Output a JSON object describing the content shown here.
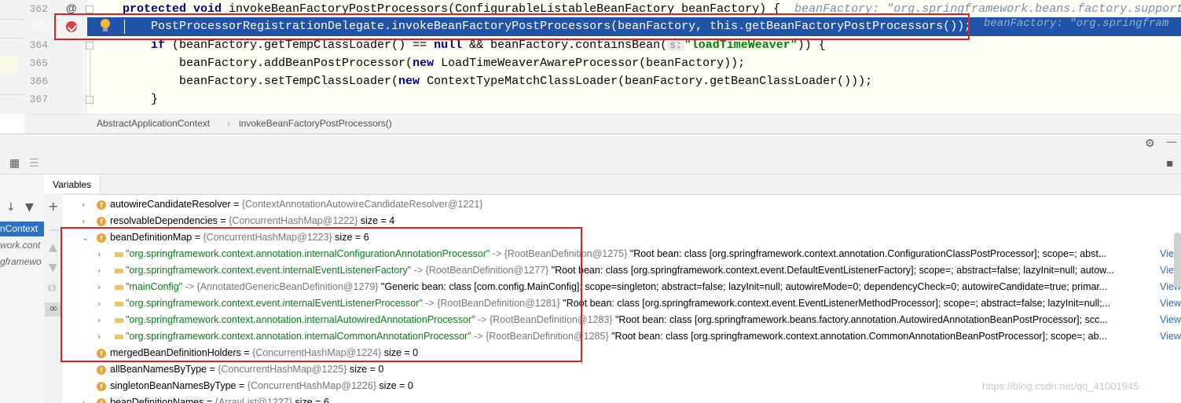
{
  "editor": {
    "lines": [
      {
        "num": "362",
        "kw": "protected void ",
        "code": "invokeBeanFactoryPostProcessors(ConfigurableListableBeanFactory beanFactory) {",
        "hint": "beanFactory: \"org.springframework.beans.factory.support"
      },
      {
        "num": "363",
        "code": "PostProcessorRegistrationDelegate.invokeBeanFactoryPostProcessors(beanFactory, this.getBeanFactoryPostProcessors());",
        "hint": "beanFactory: \"org.springfram"
      },
      {
        "num": "364",
        "kw": "if ",
        "code_a": "(beanFactory.getTempClassLoader() == ",
        "kw2": "null",
        "code_b": " && beanFactory.containsBean(",
        "param": "s:",
        "str": "\"loadTimeWeaver\"",
        "code_c": ")) {"
      },
      {
        "num": "365",
        "code_a": "beanFactory.addBeanPostProcessor(",
        "kw": "new ",
        "code_b": "LoadTimeWeaverAwareProcessor(beanFactory));"
      },
      {
        "num": "366",
        "code_a": "beanFactory.setTempClassLoader(",
        "kw": "new ",
        "code_b": "ContextTypeMatchClassLoader(beanFactory.getBeanClassLoader()));"
      },
      {
        "num": "367",
        "code": "}"
      }
    ],
    "at_symbol": "@"
  },
  "breadcrumb": {
    "class_name": "AbstractApplicationContext",
    "separator": "›",
    "method_name": "invokeBeanFactoryPostProcessors()"
  },
  "debug": {
    "tab_label": "Variables",
    "frames": [
      {
        "label": "nContext",
        "selected": true
      },
      {
        "label": "work.cont",
        "selected": false
      },
      {
        "label": "gframewo",
        "selected": false
      }
    ],
    "variables": [
      {
        "name": "autowireCandidateResolver",
        "eq": " = ",
        "value": "{ContextAnnotationAutowireCandidateResolver@1221}",
        "extra": "",
        "level": 0,
        "badge": "f",
        "arrow": "›"
      },
      {
        "name": "resolvableDependencies",
        "eq": " = ",
        "value": "{ConcurrentHashMap@1222}",
        "extra": "  size = 4",
        "level": 0,
        "badge": "f",
        "arrow": "›"
      },
      {
        "name": "beanDefinitionMap",
        "eq": " = ",
        "value": "{ConcurrentHashMap@1223}",
        "extra": "  size = 6",
        "level": 0,
        "badge": "f",
        "arrow": "⌄"
      },
      {
        "key": "\"org.springframework.context.annotation.internalConfigurationAnnotationProcessor\"",
        "op": " -> ",
        "value": "{RootBeanDefinition@1275}",
        "desc": " \"Root bean: class [org.springframework.context.annotation.ConfigurationClassPostProcessor]; scope=; abst...",
        "level": 1,
        "arrow": "›",
        "view": "View"
      },
      {
        "key": "\"org.springframework.context.event.internalEventListenerFactory\"",
        "op": " -> ",
        "value": "{RootBeanDefinition@1277}",
        "desc": " \"Root bean: class [org.springframework.context.event.DefaultEventListenerFactory]; scope=; abstract=false; lazyInit=null; autow...",
        "level": 1,
        "arrow": "›",
        "view": "View"
      },
      {
        "key": "\"mainConfig\"",
        "op": " -> ",
        "value": "{AnnotatedGenericBeanDefinition@1279}",
        "desc": " \"Generic bean: class [com.config.MainConfig]; scope=singleton; abstract=false; lazyInit=null; autowireMode=0; dependencyCheck=0; autowireCandidate=true; primar...",
        "level": 1,
        "arrow": "›",
        "view": "View"
      },
      {
        "key": "\"org.springframework.context.event.internalEventListenerProcessor\"",
        "op": " -> ",
        "value": "{RootBeanDefinition@1281}",
        "desc": " \"Root bean: class [org.springframework.context.event.EventListenerMethodProcessor]; scope=; abstract=false; lazyInit=null;...",
        "level": 1,
        "arrow": "›",
        "view": "View"
      },
      {
        "key": "\"org.springframework.context.annotation.internalAutowiredAnnotationProcessor\"",
        "op": " -> ",
        "value": "{RootBeanDefinition@1283}",
        "desc": " \"Root bean: class [org.springframework.beans.factory.annotation.AutowiredAnnotationBeanPostProcessor]; scc...",
        "level": 1,
        "arrow": "›",
        "view": "View"
      },
      {
        "key": "\"org.springframework.context.annotation.internalCommonAnnotationProcessor\"",
        "op": " -> ",
        "value": "{RootBeanDefinition@1285}",
        "desc": " \"Root bean: class [org.springframework.context.annotation.CommonAnnotationBeanPostProcessor]; scope=; ab...",
        "level": 1,
        "arrow": "›",
        "view": "View"
      },
      {
        "name": "mergedBeanDefinitionHolders",
        "eq": " = ",
        "value": "{ConcurrentHashMap@1224}",
        "extra": "  size = 0",
        "level": 0,
        "badge": "f",
        "arrow": ""
      },
      {
        "name": "allBeanNamesByType",
        "eq": " = ",
        "value": "{ConcurrentHashMap@1225}",
        "extra": "  size = 0",
        "level": 0,
        "badge": "f",
        "arrow": ""
      },
      {
        "name": "singletonBeanNamesByType",
        "eq": " = ",
        "value": "{ConcurrentHashMap@1226}",
        "extra": "  size = 0",
        "level": 0,
        "badge": "f",
        "arrow": ""
      },
      {
        "name": "beanDefinitionNames",
        "eq": " = ",
        "value": "{ArrayList@1227}",
        "extra": "  size = 6",
        "level": 0,
        "badge": "f",
        "arrow": "›"
      }
    ]
  },
  "watermark": "https://blog.csdn.net/qq_41001945",
  "colors": {
    "highlight_row": "#2154a8",
    "annotation_box": "#e02020",
    "editor_bg": "#fffef4"
  }
}
